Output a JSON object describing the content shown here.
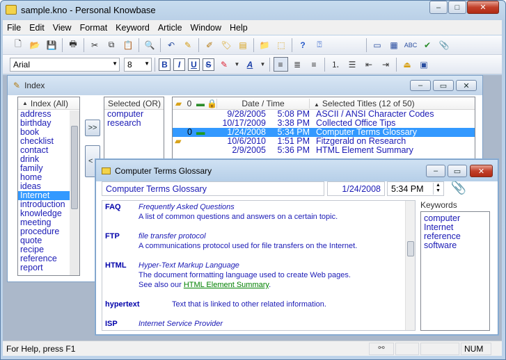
{
  "app": {
    "title": "sample.kno - Personal Knowbase",
    "controls": {
      "minimize": "–",
      "maximize": "□",
      "close": "✕"
    }
  },
  "menus": [
    "File",
    "Edit",
    "View",
    "Format",
    "Keyword",
    "Article",
    "Window",
    "Help"
  ],
  "format_toolbar": {
    "font": "Arial",
    "size": "8",
    "bold": "B",
    "italic": "I",
    "underline": "U",
    "strike": "S",
    "font_color": "A"
  },
  "index_window": {
    "title": "Index",
    "keywords_header": "Index (All)",
    "keywords": [
      "address",
      "birthday",
      "book",
      "checklist",
      "contact",
      "drink",
      "family",
      "home",
      "ideas",
      "Internet",
      "introduction",
      "knowledge",
      "meeting",
      "procedure",
      "quote",
      "recipe",
      "reference",
      "report"
    ],
    "selected_keyword": "Internet",
    "add_button": ">>",
    "remove_button": "<",
    "selected_header": "Selected (OR)",
    "selected_keywords": [
      "computer",
      "research"
    ],
    "titles_header": {
      "date_time": "Date / Time",
      "titles": "Selected Titles (12 of 50)"
    },
    "articles": [
      {
        "date": "9/28/2005",
        "time": "5:08 PM",
        "title": "ASCII / ANSI Character Codes",
        "selected": false,
        "tag": "",
        "attach": false,
        "link": false
      },
      {
        "date": "10/17/2009",
        "time": "3:38 PM",
        "title": "Collected Office Tips",
        "selected": false,
        "tag": "",
        "attach": false,
        "link": false
      },
      {
        "date": "1/24/2008",
        "time": "5:34 PM",
        "title": "Computer Terms Glossary",
        "selected": true,
        "tag": "",
        "attach": true,
        "link": true
      },
      {
        "date": "10/6/2010",
        "time": "1:51 PM",
        "title": "Fitzgerald on Research",
        "selected": false,
        "tag": "yellow",
        "attach": false,
        "link": false
      },
      {
        "date": "2/9/2005",
        "time": "5:36 PM",
        "title": "HTML Element Summary",
        "selected": false,
        "tag": "",
        "attach": false,
        "link": false
      }
    ]
  },
  "article_window": {
    "title": "Computer Terms Glossary",
    "article_title": "Computer Terms Glossary",
    "date": "1/24/2008",
    "time": "5:34 PM",
    "keywords_label": "Keywords",
    "keywords": [
      "computer",
      "Internet",
      "reference",
      "software"
    ],
    "entries": [
      {
        "term": "FAQ",
        "heading": "Frequently Asked Questions",
        "lines": [
          "A list of common questions and answers on a certain topic."
        ]
      },
      {
        "term": "FTP",
        "heading": "file transfer protocol",
        "lines": [
          "A communications protocol used for file transfers on the Internet."
        ]
      },
      {
        "term": "HTML",
        "heading": "Hyper-Text Markup Language",
        "lines": [
          "The document formatting language used to create Web pages."
        ],
        "see_also_prefix": "See also our ",
        "see_also_link": "HTML Element Summary",
        "see_also_suffix": "."
      },
      {
        "term": "hypertext",
        "inline": "Text that is linked to other related information."
      },
      {
        "term": "ISP",
        "heading": "Internet Service Provider"
      }
    ]
  },
  "status_bar": {
    "help_text": "For Help, press F1",
    "num": "NUM"
  },
  "colors": {
    "selection": "#3399ff",
    "link_text": "#1a1ab5",
    "hyperlink": "#008000"
  }
}
